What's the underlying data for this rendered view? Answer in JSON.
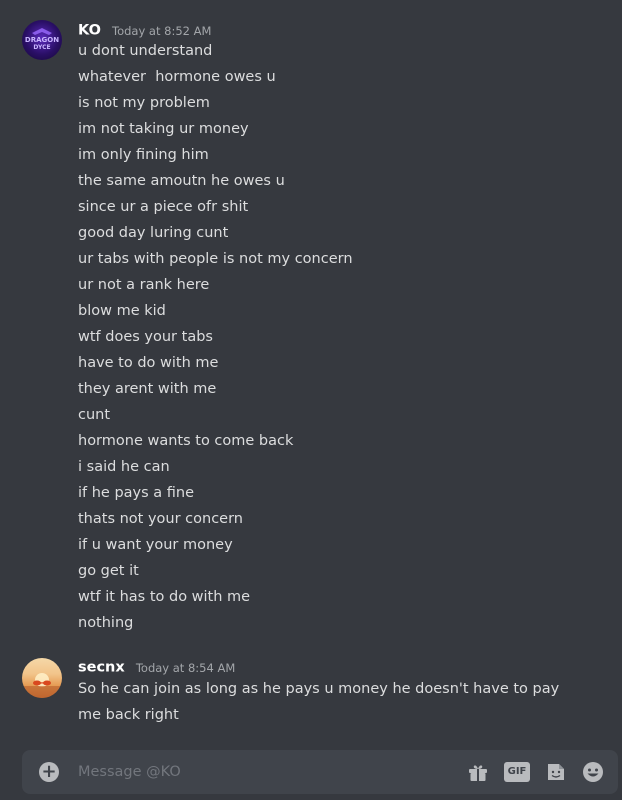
{
  "messages": [
    {
      "username": "KO",
      "timestamp": "Today at 8:52 AM",
      "avatar_text": "DRAGON DYCE",
      "lines": [
        "u dont understand",
        "whatever  hormone owes u",
        "is not my problem",
        "im not taking ur money",
        "im only fining him",
        "the same amoutn he owes u",
        "since ur a piece ofr shit",
        "good day luring cunt",
        "ur tabs with people is not my concern",
        "ur not a rank here",
        "blow me kid",
        "wtf does your tabs",
        "have to do with me",
        "they arent with me",
        "cunt",
        "hormone wants to come back",
        "i said he can",
        "if he pays a fine",
        "thats not your concern",
        "if u want your money",
        "go get it",
        "wtf it has to do with me",
        "nothing"
      ]
    },
    {
      "username": "secnx",
      "timestamp": "Today at 8:54 AM",
      "lines": [
        "So he can join as long as he pays u money he doesn't have to pay me back right"
      ]
    }
  ],
  "composer": {
    "placeholder": "Message @KO",
    "gif_label": "GIF",
    "icons": [
      "plus-icon",
      "gift-icon",
      "gif-icon",
      "sticker-icon",
      "emoji-icon"
    ]
  }
}
